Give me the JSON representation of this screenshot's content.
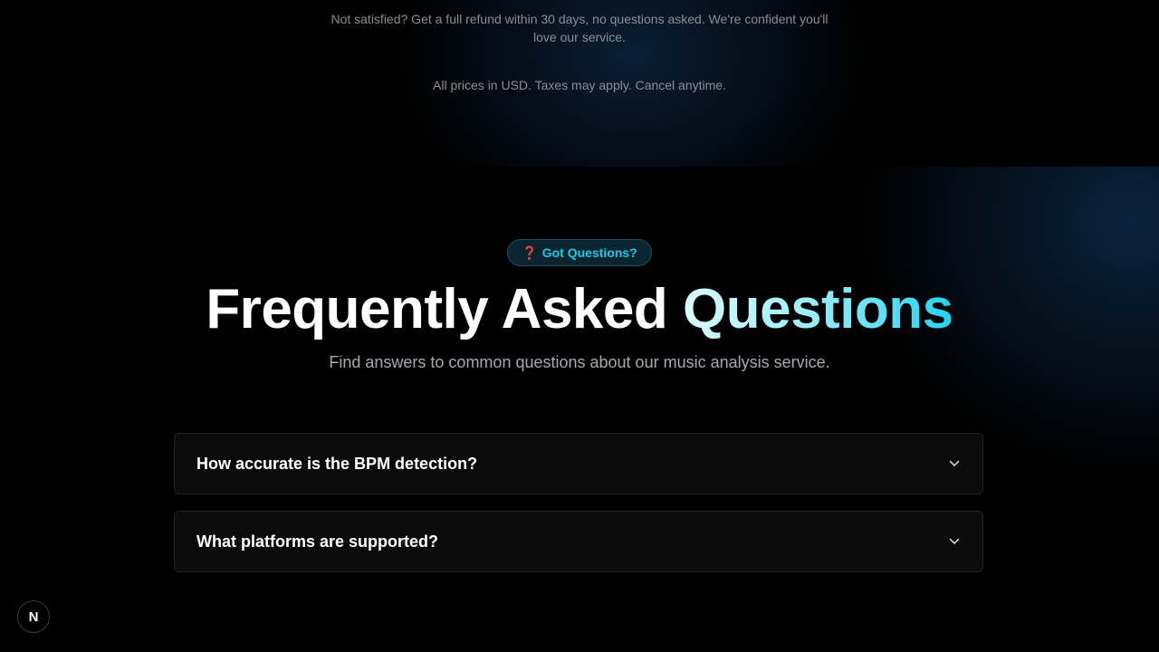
{
  "pricing": {
    "refund_note": "Not satisfied? Get a full refund within 30 days, no questions asked. We're confident you'll love our service.",
    "prices_note": "All prices in USD. Taxes may apply. Cancel anytime."
  },
  "faq": {
    "badge": {
      "icon": "question-mark-icon",
      "icon_glyph": "❓",
      "label": "Got Questions?"
    },
    "title_plain": "Frequently Asked",
    "title_accent": "Questions",
    "subtitle": "Find answers to common questions about our music analysis service.",
    "items": [
      {
        "question": "How accurate is the BPM detection?",
        "expanded": false
      },
      {
        "question": "What platforms are supported?",
        "expanded": false
      }
    ]
  },
  "dev_indicator": {
    "label": "N",
    "icon": "nextjs-logo-icon"
  },
  "colors": {
    "background": "#000000",
    "accent": "#22d3ee",
    "muted_text": "#8a8f98",
    "card_bg": "#0b0b0c",
    "card_border": "#232326"
  }
}
